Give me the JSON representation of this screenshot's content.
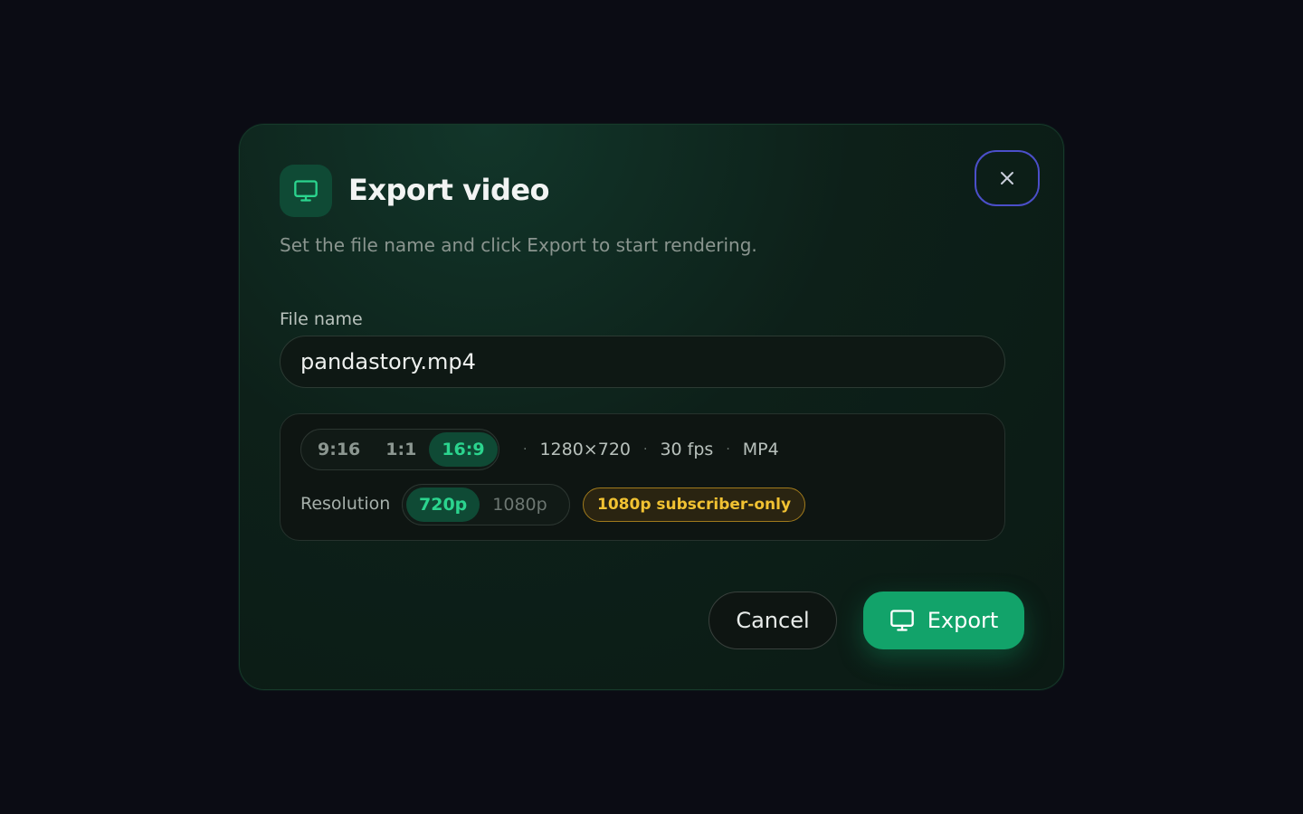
{
  "dialog": {
    "title": "Export video",
    "subtitle": "Set the file name and click Export to start rendering.",
    "header_icon": "monitor-icon",
    "close_icon": "close-icon"
  },
  "file": {
    "label": "File name",
    "value": "pandastory.mp4"
  },
  "aspect": {
    "options": [
      "9:16",
      "1:1",
      "16:9"
    ],
    "selected": "16:9"
  },
  "meta": {
    "dimensions": "1280×720",
    "fps": "30 fps",
    "format": "MP4",
    "separator": "·"
  },
  "resolution": {
    "label": "Resolution",
    "options": [
      "720p",
      "1080p"
    ],
    "selected": "720p",
    "badge": "1080p subscriber-only"
  },
  "actions": {
    "cancel_label": "Cancel",
    "export_label": "Export",
    "export_icon": "monitor-icon"
  },
  "colors": {
    "accent": "#12a36a",
    "accent_text": "#2bd48e",
    "badge": "#f1c232",
    "focus_ring": "#4b4fc9"
  }
}
